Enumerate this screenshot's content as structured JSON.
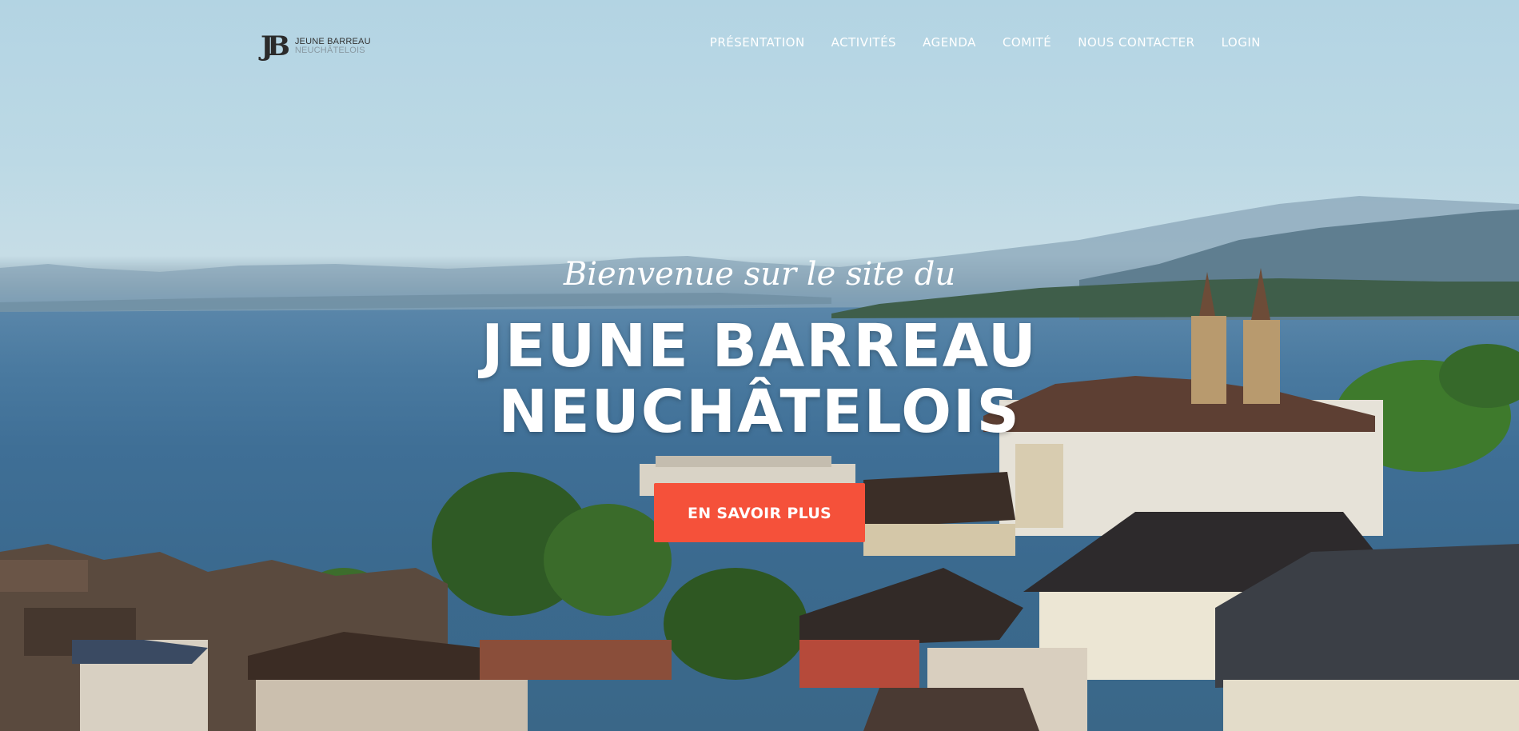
{
  "header": {
    "logo": {
      "mark": "JB",
      "line1": "JEUNE BARREAU",
      "line2": "NEUCHÂTELOIS"
    },
    "menu": [
      {
        "label": "PRÉSENTATION"
      },
      {
        "label": "ACTIVITÉS"
      },
      {
        "label": "AGENDA"
      },
      {
        "label": "COMITÉ"
      },
      {
        "label": "NOUS CONTACTER"
      },
      {
        "label": "LOGIN"
      }
    ]
  },
  "hero": {
    "subtitle": "Bienvenue sur le site du",
    "title_line1": "JEUNE BARREAU",
    "title_line2": "NEUCHÂTELOIS",
    "cta_label": "EN SAVOIR PLUS"
  },
  "colors": {
    "accent": "#f5513a",
    "nav_text": "#ffffff",
    "sky": "#b3d4e3",
    "lake": "#3f6f96"
  },
  "icons": {
    "logo": "jb-monogram-icon"
  }
}
